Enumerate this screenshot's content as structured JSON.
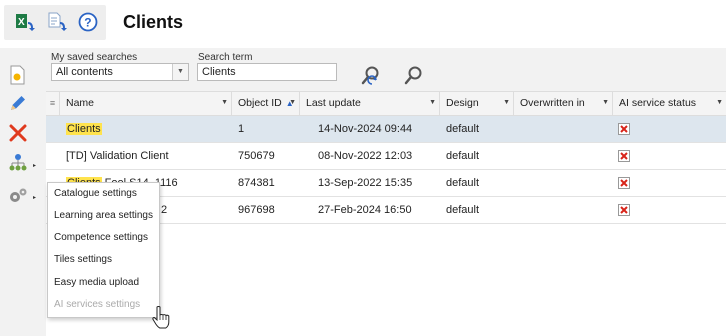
{
  "header": {
    "title": "Clients",
    "tools": [
      {
        "icon": "excel-export-icon"
      },
      {
        "icon": "document-export-icon"
      },
      {
        "icon": "help-icon"
      }
    ]
  },
  "search": {
    "saved_label": "My saved searches",
    "saved_value": "All contents",
    "term_label": "Search term",
    "term_value": "Clients"
  },
  "grid": {
    "columns": [
      "Name",
      "Object ID",
      "Last update",
      "Design",
      "Overwritten in",
      "AI service status"
    ],
    "sort_column": "Object ID",
    "rows": [
      {
        "name_hl": "Clients",
        "name_rest": "",
        "id": "1",
        "updated": "14-Nov-2024 09:44",
        "design": "default",
        "overwritten": ""
      },
      {
        "name_hl": "",
        "name_rest": "[TD] Validation Client",
        "id": "750679",
        "updated": "08-Nov-2022 12:03",
        "design": "default",
        "overwritten": ""
      },
      {
        "name_hl": "Clients",
        "name_rest": " Fool S14, 1116",
        "id": "874381",
        "updated": "13-Sep-2022 15:35",
        "design": "default",
        "overwritten": ""
      },
      {
        "name_hl": "",
        "name_rest": "2",
        "id": "967698",
        "updated": "27-Feb-2024 16:50",
        "design": "default",
        "overwritten": ""
      }
    ]
  },
  "context_menu": {
    "items": [
      {
        "label": "Catalogue settings",
        "enabled": true
      },
      {
        "label": "Learning area settings",
        "enabled": true
      },
      {
        "label": "Competence settings",
        "enabled": true
      },
      {
        "label": "Tiles settings",
        "enabled": true
      },
      {
        "label": "Easy media upload",
        "enabled": true
      },
      {
        "label": "AI services settings",
        "enabled": false
      }
    ]
  },
  "colors": {
    "highlight": "#ffe34d",
    "selected_row": "#dde6ee",
    "accent_blue": "#2a63c4",
    "delete_red": "#e03a1e"
  }
}
